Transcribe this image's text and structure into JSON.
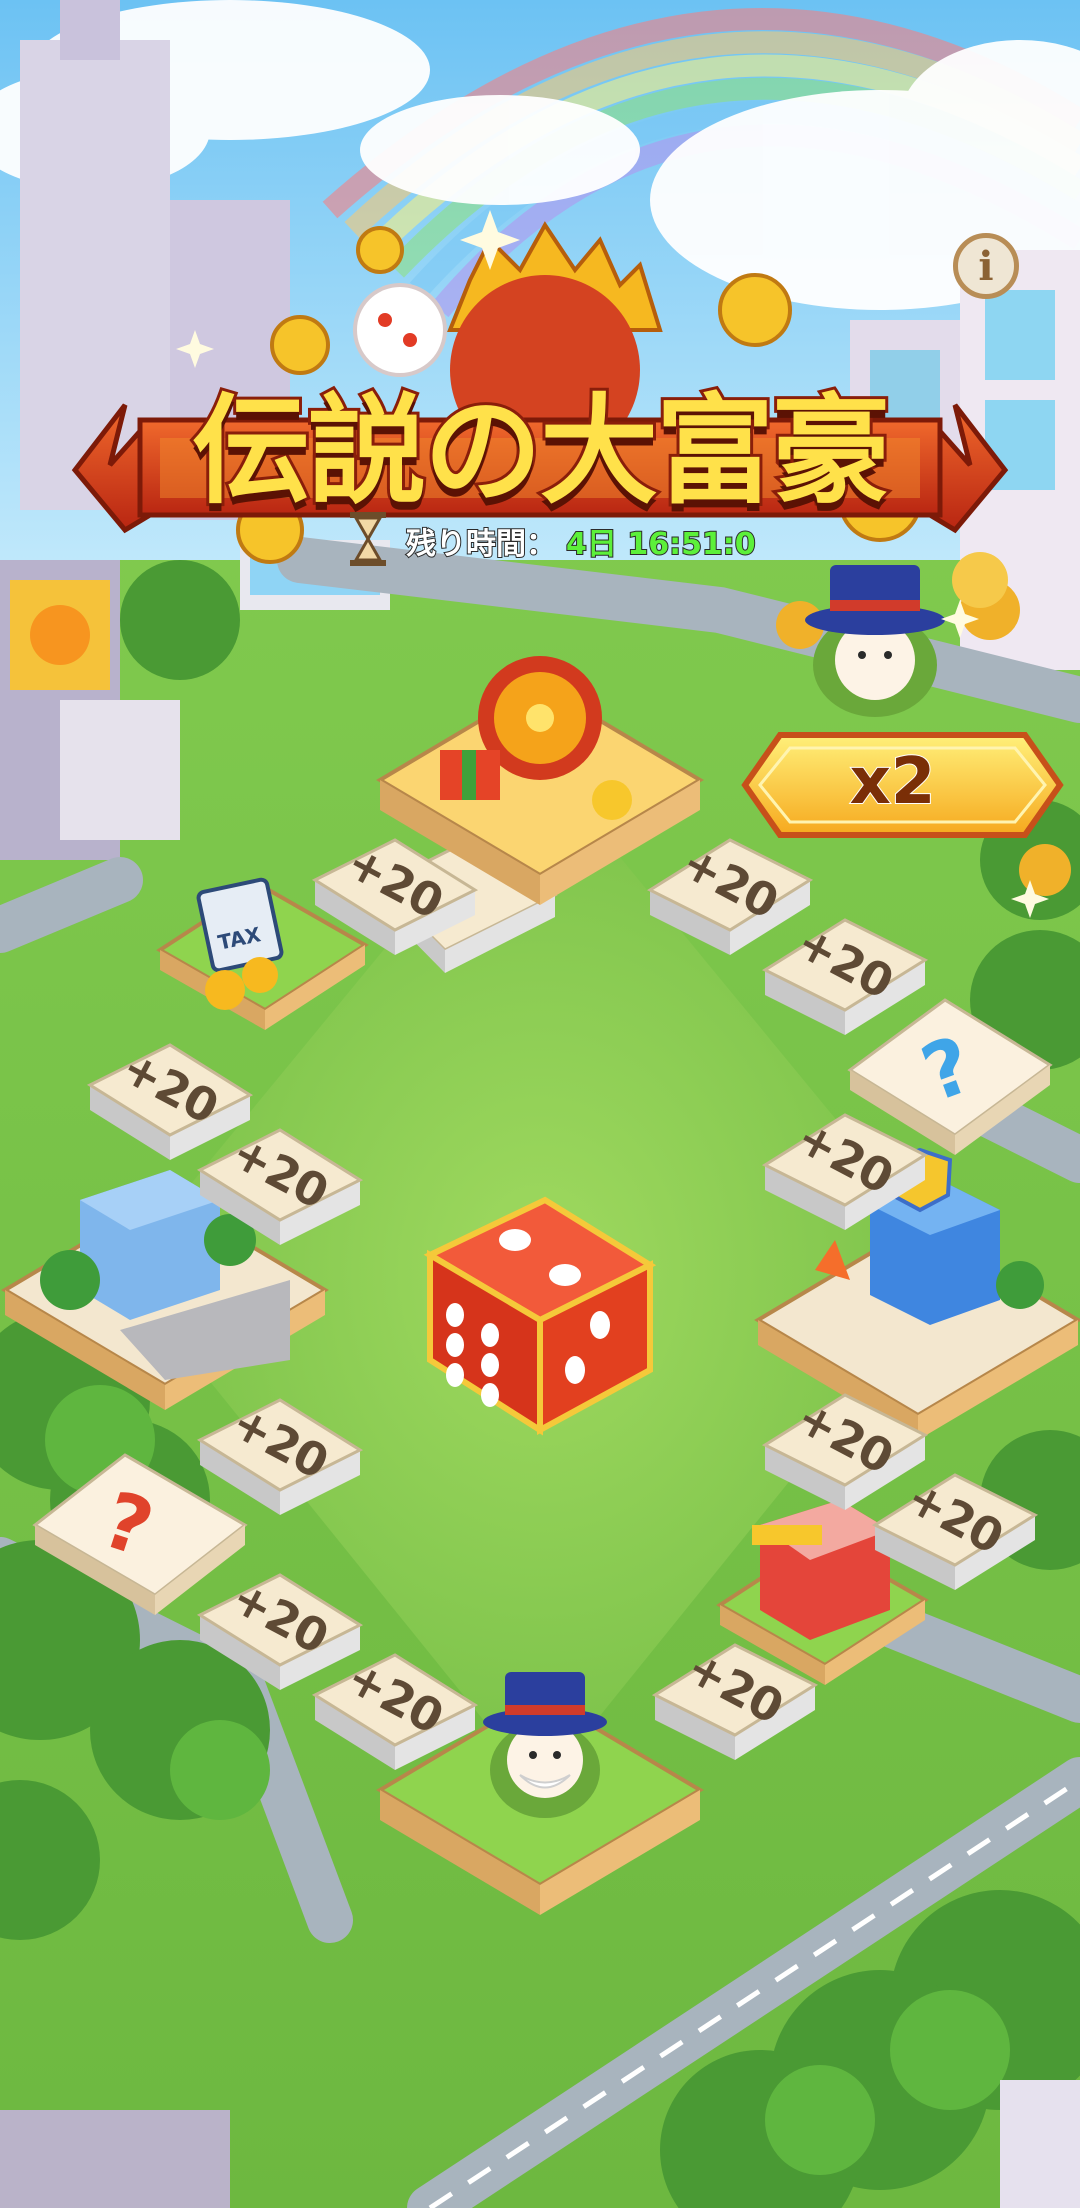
{
  "event": {
    "title": "伝説の大富豪",
    "timer_label": "残り時間：",
    "timer_value": "4日 16:51:0",
    "info_icon": "info-icon",
    "multiplier": "x2"
  },
  "board": {
    "tile_reward": "+20",
    "mystery_symbol": "?",
    "tax_sign": "TAX",
    "center_action": "roll-dice"
  },
  "colors": {
    "grass": "#78c24a",
    "title_fill": "#ffe14a",
    "title_stroke": "#8a1e0a",
    "timer_value": "#5cf03a",
    "ribbon_red": "#d8401c",
    "badge_gold": "#ffd23a",
    "tile_cream": "#f6ead0",
    "tile_silver": "#d6d6d6",
    "dice_red": "#e3391f",
    "mystery_red": "#e0432b",
    "mystery_blue": "#3fa5e8"
  }
}
